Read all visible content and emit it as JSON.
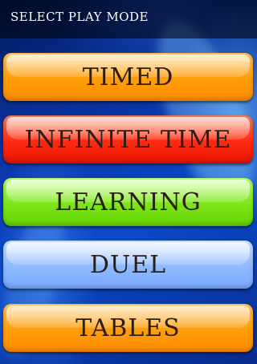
{
  "header": {
    "title": "SELECT PLAY MODE"
  },
  "modes": [
    {
      "label": "TIMED",
      "color": "#ff9d0a"
    },
    {
      "label": "INFINITE TIME",
      "color": "#ff2a10"
    },
    {
      "label": "LEARNING",
      "color": "#7ee51a"
    },
    {
      "label": "DUEL",
      "color": "#8fbaff"
    },
    {
      "label": "TABLES",
      "color": "#ff9d0a"
    }
  ],
  "colors": {
    "background": "#0a3ab0",
    "header_background": "#000000",
    "label_text": "#2a1f14"
  }
}
